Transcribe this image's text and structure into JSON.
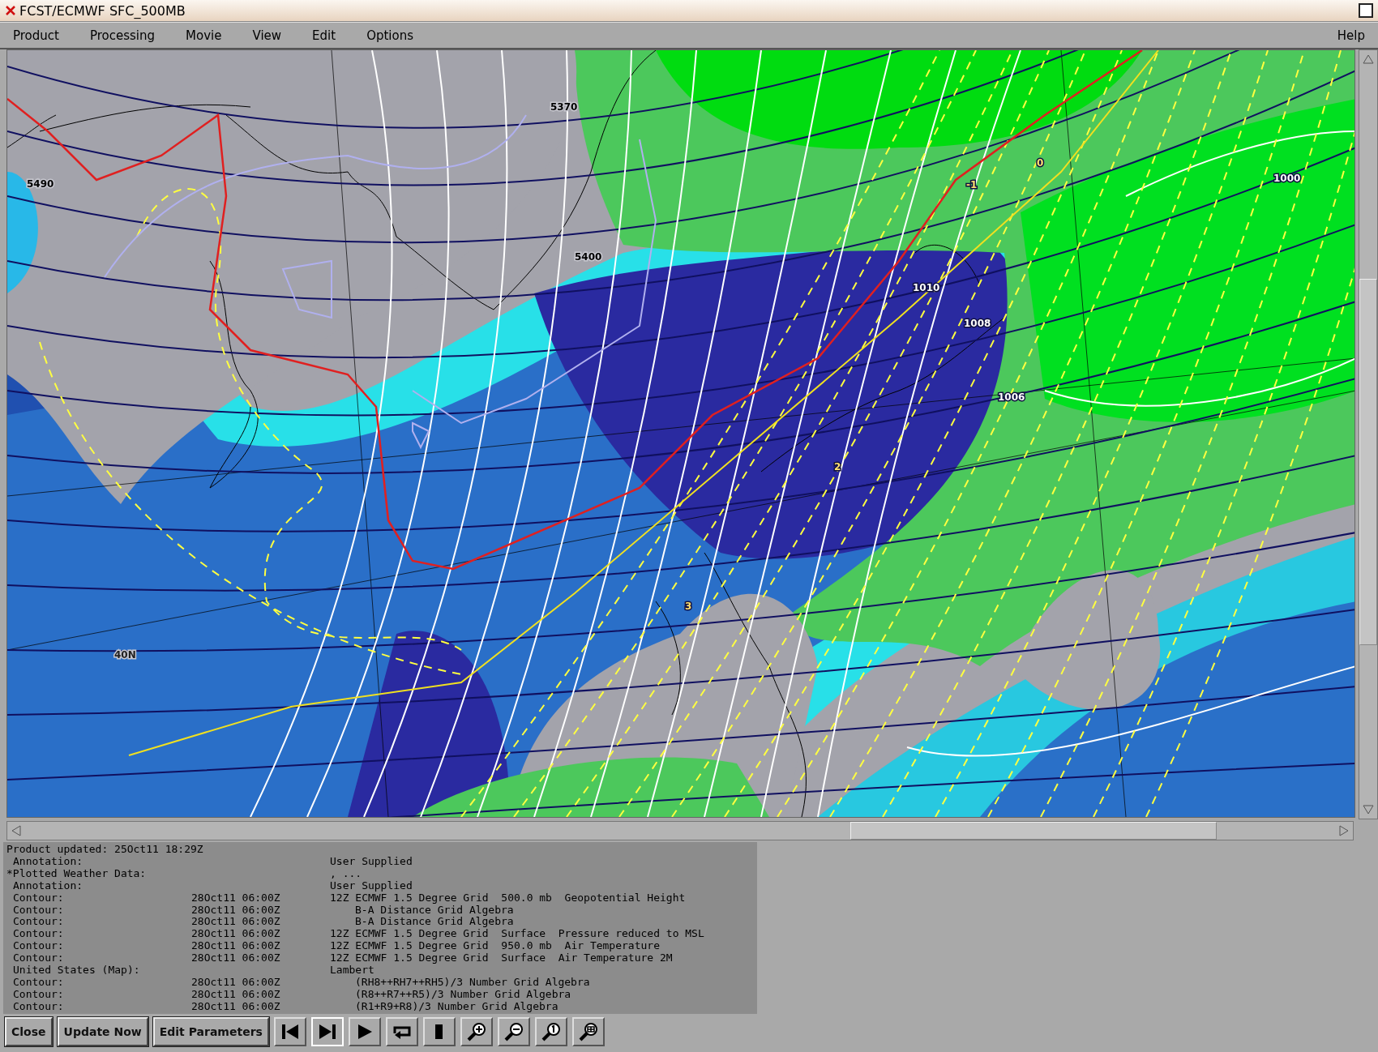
{
  "window": {
    "title": "FCST/ECMWF SFC_500MB"
  },
  "menu": {
    "items": [
      "Product",
      "Processing",
      "Movie",
      "View",
      "Edit",
      "Options"
    ],
    "help": "Help"
  },
  "map": {
    "labels": [
      {
        "text": "5370"
      },
      {
        "text": "5490"
      },
      {
        "text": "5400"
      },
      {
        "text": "1010"
      },
      {
        "text": "1008"
      },
      {
        "text": "1006"
      },
      {
        "text": "1000"
      },
      {
        "text": "0"
      },
      {
        "text": "-1"
      },
      {
        "text": "2"
      },
      {
        "text": "3"
      },
      {
        "text": "40N"
      }
    ]
  },
  "info": {
    "updated": "Product updated: 25Oct11 18:29Z",
    "rows": [
      {
        "kind": "entry",
        "label": "Annotation:",
        "description": "User Supplied",
        "indent": false
      },
      {
        "kind": "header",
        "label": "*Plotted Weather Data:",
        "description": ", ...",
        "indent": false
      },
      {
        "kind": "entry",
        "label": "Annotation:",
        "description": "User Supplied",
        "indent": false
      },
      {
        "kind": "entry",
        "label": "Contour:",
        "time": "28Oct11 06:00Z",
        "description": "12Z ECMWF 1.5 Degree Grid  500.0 mb  Geopotential Height",
        "indent": false
      },
      {
        "kind": "entry",
        "label": "Contour:",
        "time": "28Oct11 06:00Z",
        "description": "B-A Distance Grid Algebra",
        "indent": true
      },
      {
        "kind": "entry",
        "label": "Contour:",
        "time": "28Oct11 06:00Z",
        "description": "B-A Distance Grid Algebra",
        "indent": true
      },
      {
        "kind": "entry",
        "label": "Contour:",
        "time": "28Oct11 06:00Z",
        "description": "12Z ECMWF 1.5 Degree Grid  Surface  Pressure reduced to MSL",
        "indent": false
      },
      {
        "kind": "entry",
        "label": "Contour:",
        "time": "28Oct11 06:00Z",
        "description": "12Z ECMWF 1.5 Degree Grid  950.0 mb  Air Temperature",
        "indent": false
      },
      {
        "kind": "entry",
        "label": "Contour:",
        "time": "28Oct11 06:00Z",
        "description": "12Z ECMWF 1.5 Degree Grid  Surface  Air Temperature 2M",
        "indent": false
      },
      {
        "kind": "entry",
        "label": "United States (Map):",
        "description": "Lambert",
        "indent": false
      },
      {
        "kind": "entry",
        "label": "Contour:",
        "time": "28Oct11 06:00Z",
        "description": "(RH8++RH7++RH5)/3 Number Grid Algebra",
        "indent": true
      },
      {
        "kind": "entry",
        "label": "Contour:",
        "time": "28Oct11 06:00Z",
        "description": "(R8++R7++R5)/3 Number Grid Algebra",
        "indent": true
      },
      {
        "kind": "entry",
        "label": "Contour:",
        "time": "28Oct11 06:00Z",
        "description": "(R1+R9+R8)/3 Number Grid Algebra",
        "indent": true
      }
    ]
  },
  "toolbar": {
    "buttons": [
      "Close",
      "Update Now",
      "Edit Parameters"
    ],
    "controls": [
      {
        "kind": "first",
        "selected": false
      },
      {
        "kind": "last",
        "selected": true
      },
      {
        "kind": "play",
        "selected": false
      },
      {
        "kind": "loop",
        "selected": false
      },
      {
        "kind": "stop",
        "selected": false
      },
      {
        "kind": "zoom-in",
        "selected": false
      },
      {
        "kind": "zoom-out",
        "selected": false
      },
      {
        "kind": "zoom-one",
        "selected": false
      },
      {
        "kind": "zoom-fit",
        "selected": false
      }
    ]
  }
}
